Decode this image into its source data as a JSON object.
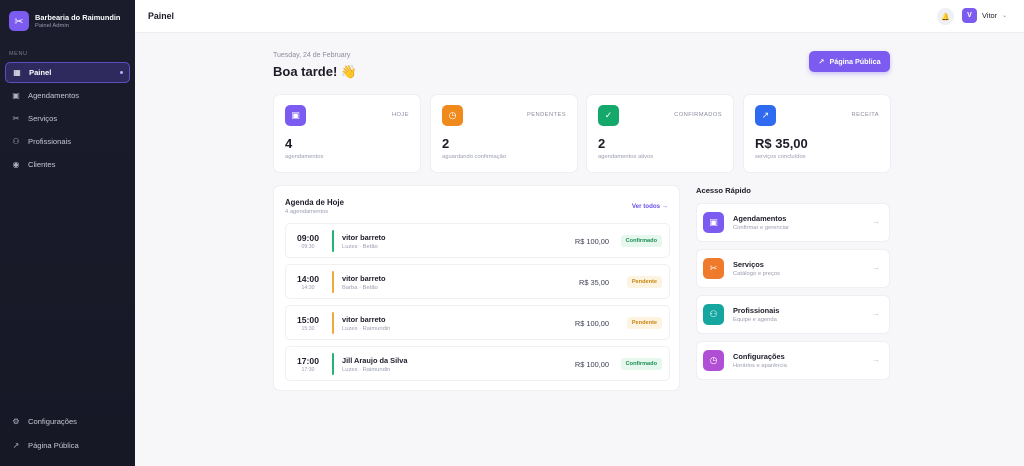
{
  "sidebar": {
    "brand_name": "Barbearia do Raimundin",
    "brand_sub": "Painel Admin",
    "menu_label": "MENU",
    "items": [
      {
        "label": "Painel",
        "icon": "dashboard-icon"
      },
      {
        "label": "Agendamentos",
        "icon": "calendar-icon"
      },
      {
        "label": "Serviços",
        "icon": "scissors-icon"
      },
      {
        "label": "Profissionais",
        "icon": "users-icon"
      },
      {
        "label": "Clientes",
        "icon": "user-circle-icon"
      }
    ],
    "bottom_items": [
      {
        "label": "Configurações",
        "icon": "gear-icon"
      },
      {
        "label": "Página Pública",
        "icon": "external-link-icon"
      }
    ]
  },
  "topbar": {
    "title": "Painel",
    "user_initial": "V",
    "user_name": "Vitor"
  },
  "header": {
    "date": "Tuesday, 24 de February",
    "greeting": "Boa tarde! 👋",
    "public_button": "Página Pública"
  },
  "stats": [
    {
      "label": "HOJE",
      "value": "4",
      "sub": "agendamentos",
      "color": "#7c5cf0",
      "icon": "calendar-icon"
    },
    {
      "label": "PENDENTES",
      "value": "2",
      "sub": "aguardando confirmação",
      "color": "#f08a1c",
      "icon": "clock-icon"
    },
    {
      "label": "CONFIRMADOS",
      "value": "2",
      "sub": "agendamentos ativos",
      "color": "#14a86b",
      "icon": "check-circle-icon"
    },
    {
      "label": "RECEITA",
      "value": "R$ 35,00",
      "sub": "serviços concluídos",
      "color": "#2f6bf0",
      "icon": "trending-up-icon"
    }
  ],
  "agenda": {
    "title": "Agenda de Hoje",
    "subtitle": "4 agendamentos",
    "view_all": "Ver todos →",
    "appointments": [
      {
        "start": "09:00",
        "end": "09:30",
        "client": "vitor barreto",
        "service": "Luzes · Betão",
        "price": "R$ 100,00",
        "status": "Confirmado",
        "bar_color": "#22b573"
      },
      {
        "start": "14:00",
        "end": "14:30",
        "client": "vitor barreto",
        "service": "Barba · Betão",
        "price": "R$ 35,00",
        "status": "Pendente",
        "bar_color": "#f2a93b"
      },
      {
        "start": "15:00",
        "end": "15:30",
        "client": "vitor barreto",
        "service": "Luzes · Raimundin",
        "price": "R$ 100,00",
        "status": "Pendente",
        "bar_color": "#f2a93b"
      },
      {
        "start": "17:00",
        "end": "17:30",
        "client": "Jill Araujo da Silva",
        "service": "Luzes · Raimundin",
        "price": "R$ 100,00",
        "status": "Confirmado",
        "bar_color": "#22b573"
      }
    ]
  },
  "quick_access": {
    "title": "Acesso Rápido",
    "items": [
      {
        "name": "Agendamentos",
        "sub": "Confirmar e gerenciar",
        "color": "#7c5cf0",
        "icon": "calendar-icon"
      },
      {
        "name": "Serviços",
        "sub": "Catálogo e preços",
        "color": "#f07a2c",
        "icon": "scissors-icon"
      },
      {
        "name": "Profissionais",
        "sub": "Equipe e agenda",
        "color": "#16a6a0",
        "icon": "users-icon"
      },
      {
        "name": "Configurações",
        "sub": "Horários e aparência",
        "color": "#b04fd6",
        "icon": "clock-icon"
      }
    ]
  }
}
